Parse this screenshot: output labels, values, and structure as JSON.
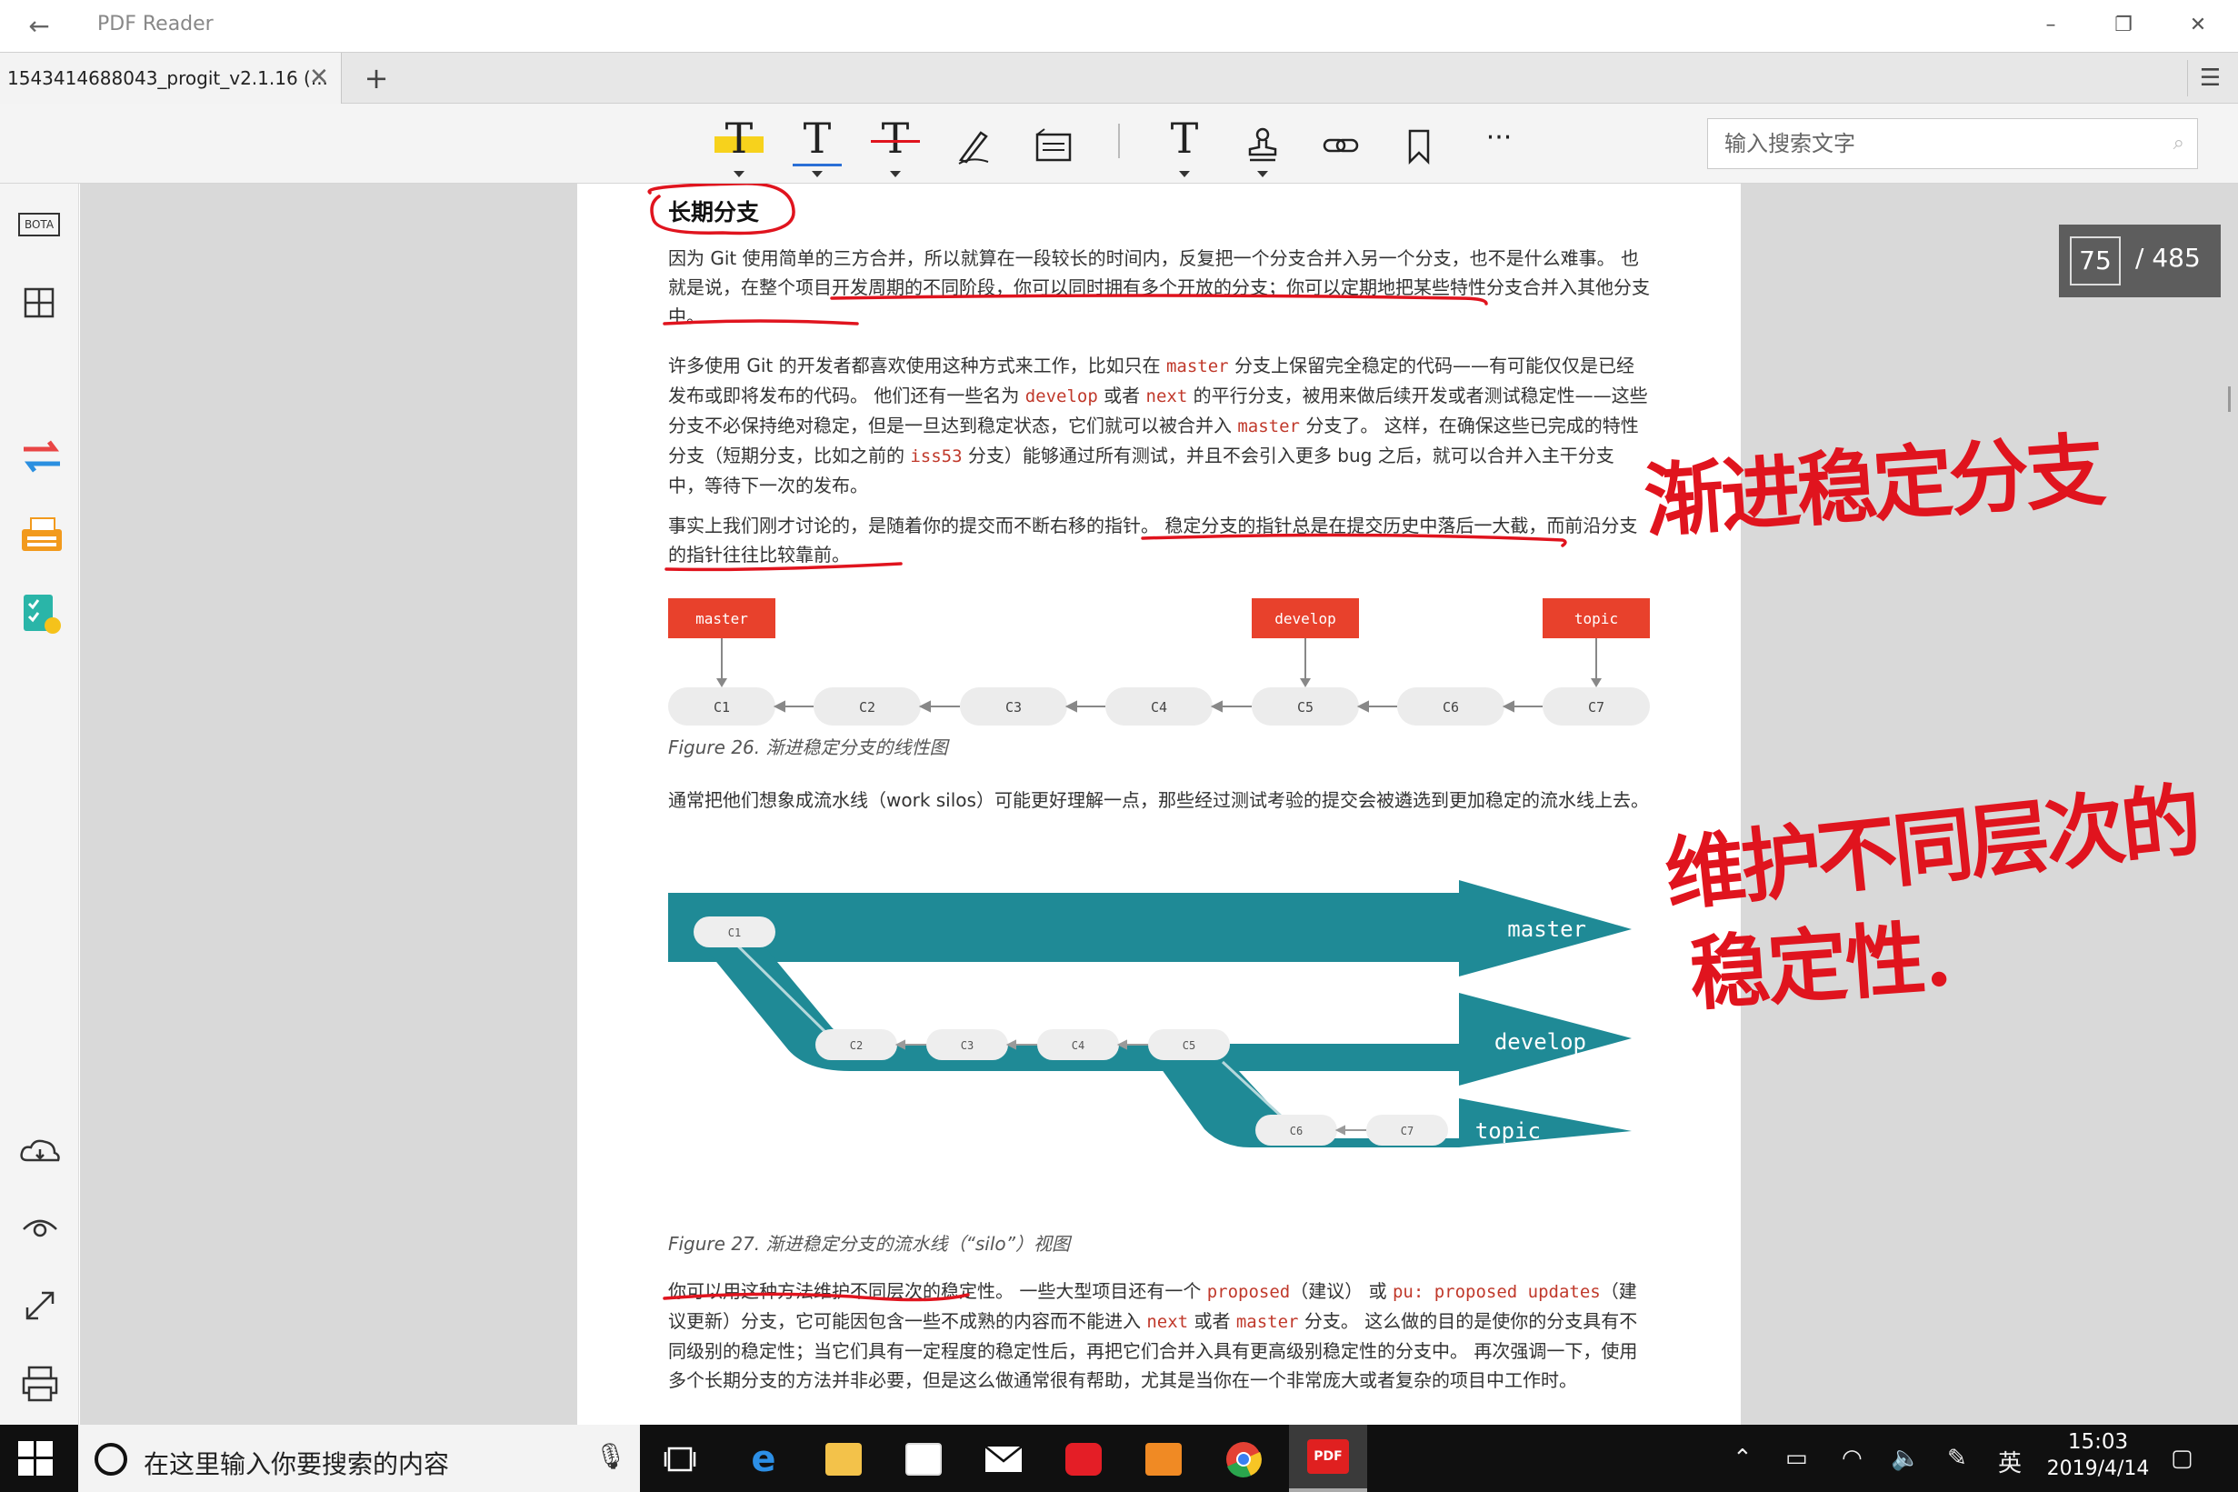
{
  "window": {
    "title": "PDF Reader",
    "back_icon": "arrow-left",
    "minimize": "–",
    "restore": "❐",
    "close": "✕"
  },
  "tabs": {
    "active_tab": "1543414688043_progit_v2.1.16 (...",
    "close": "✕",
    "new_tab": "+",
    "menu": "☰"
  },
  "toolbar": {
    "search_placeholder": "输入搜索文字",
    "tools": [
      "highlight-text",
      "underline-text",
      "strikethrough-text",
      "pen",
      "area-note",
      "text-box",
      "stamp",
      "link",
      "bookmark",
      "more"
    ],
    "more": "···"
  },
  "sidebar": {
    "bota_label": "BOTA",
    "icons": [
      "bota-icon",
      "thumbnails-icon",
      "convert-icon",
      "fax-icon",
      "checklist-icon",
      "cloud-icon",
      "view-mode-icon",
      "fullscreen-icon",
      "print-icon"
    ]
  },
  "page_counter": {
    "current": "75",
    "total": "/ 485"
  },
  "document": {
    "heading": "长期分支",
    "para1": " 因为 Git 使用简单的三方合并，所以就算在一段较长的时间内，反复把一个分支合并入另一个分支，也不是什么难事。 也就是说，在整个项目开发周期的不同阶段，你可以同时拥有多个开放的分支；你可以定期地把某些特性分支合并入其他分支中。",
    "para2_a": "许多使用 Git 的开发者都喜欢使用这种方式来工作，比如只在 ",
    "para2_code1": "master",
    "para2_b": " 分支上保留完全稳定的代码——有可能仅仅是已经发布或即将发布的代码。 他们还有一些名为 ",
    "para2_code2": "develop",
    "para2_c": " 或者 ",
    "para2_code3": "next",
    "para2_d": " 的平行分支，被用来做后续开发或者测试稳定性——这些分支不必保持绝对稳定，但是一旦达到稳定状态，它们就可以被合并入 ",
    "para2_code4": "master",
    "para2_e": " 分支了。 这样，在确保这些已完成的特性分支（短期分支，比如之前的 ",
    "para2_code5": "iss53",
    "para2_f": " 分支）能够通过所有测试，并且不会引入更多 bug 之后，就可以合并入主干分支中，等待下一次的发布。",
    "para3": "事实上我们刚才讨论的，是随着你的提交而不断右移的指针。 稳定分支的指针总是在提交历史中落后一大截，而前沿分支的指针往往比较靠前。",
    "figure26_caption": "Figure 26. 渐进稳定分支的线性图",
    "para4": "通常把他们想象成流水线（work silos）可能更好理解一点，那些经过测试考验的提交会被遴选到更加稳定的流水线上去。",
    "figure27_caption": "Figure 27. 渐进稳定分支的流水线（“silo”）视图",
    "para5_a": "你可以用这种方法维护不同层次的稳定性。 一些大型项目还有一个 ",
    "para5_code1": "proposed",
    "para5_b": "（建议） 或 ",
    "para5_code2": "pu: proposed updates",
    "para5_c": "（建议更新）分支，它可能因包含一些不成熟的内容而不能进入 ",
    "para5_code3": "next",
    "para5_d": " 或者 ",
    "para5_code4": "master",
    "para5_e": " 分支。 这么做的目的是使你的分支具有不同级别的稳定性；当它们具有一定程度的稳定性后，再把它们合并入具有更高级别稳定性的分支中。 再次强调一下，使用多个长期分支的方法并非必要，但是这么做通常很有帮助，尤其是当你在一个非常庞大或者复杂的项目中工作时。"
  },
  "figure26": {
    "labels": [
      "master",
      "develop",
      "topic"
    ],
    "commits": [
      "C1",
      "C2",
      "C3",
      "C4",
      "C5",
      "C6",
      "C7"
    ]
  },
  "figure27": {
    "branches": [
      "master",
      "develop",
      "topic"
    ],
    "master_commits": [
      "C1"
    ],
    "develop_commits": [
      "C2",
      "C3",
      "C4",
      "C5"
    ],
    "topic_commits": [
      "C6",
      "C7"
    ]
  },
  "annotations": {
    "note1": "渐进稳定分支",
    "note2_line1": "维护不同层次的",
    "note2_line2": "稳定性."
  },
  "taskbar": {
    "search_text": "在这里输入你要搜索的内容",
    "apps": [
      "task-view",
      "edge",
      "file-explorer",
      "store",
      "mail",
      "netease-music",
      "app-orange",
      "chrome",
      "pdf-reader"
    ],
    "pdf_label": "PDF",
    "ime": "英",
    "time": "15:03",
    "date": "2019/4/14"
  },
  "colors": {
    "accent_red": "#e8412c",
    "ink_red": "#e0141e",
    "teal": "#1f8a96",
    "code_red": "#c0392b"
  }
}
